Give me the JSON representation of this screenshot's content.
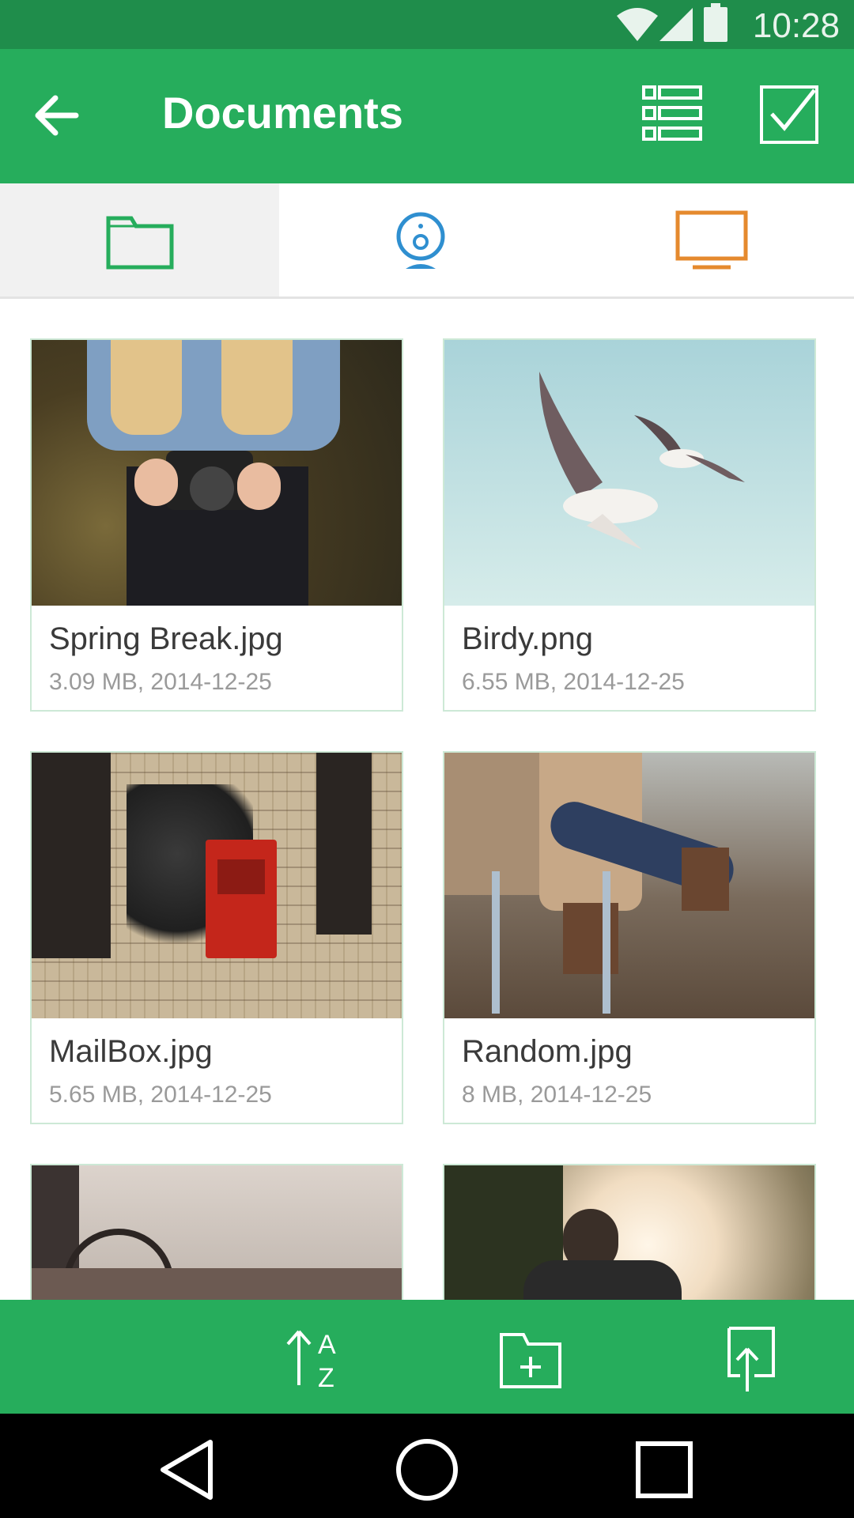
{
  "status": {
    "time": "10:28"
  },
  "header": {
    "title": "Documents"
  },
  "tabs": [
    {
      "icon": "folder-icon",
      "active": true,
      "color": "#26ad5c"
    },
    {
      "icon": "webcam-icon",
      "active": false,
      "color": "#2f8fd0"
    },
    {
      "icon": "monitor-icon",
      "active": false,
      "color": "#e58a2e"
    }
  ],
  "files": [
    {
      "name": "Spring Break.jpg",
      "meta": "3.09 MB, 2014-12-25"
    },
    {
      "name": "Birdy.png",
      "meta": "6.55 MB, 2014-12-25"
    },
    {
      "name": "MailBox.jpg",
      "meta": "5.65 MB, 2014-12-25"
    },
    {
      "name": "Random.jpg",
      "meta": "8 MB, 2014-12-25"
    },
    {
      "name": "",
      "meta": ""
    },
    {
      "name": "",
      "meta": ""
    }
  ],
  "bottom_actions": [
    "sort-az-icon",
    "new-folder-icon",
    "upload-icon"
  ],
  "colors": {
    "accent": "#26ad5c",
    "status_bar": "#1f8d4b"
  }
}
